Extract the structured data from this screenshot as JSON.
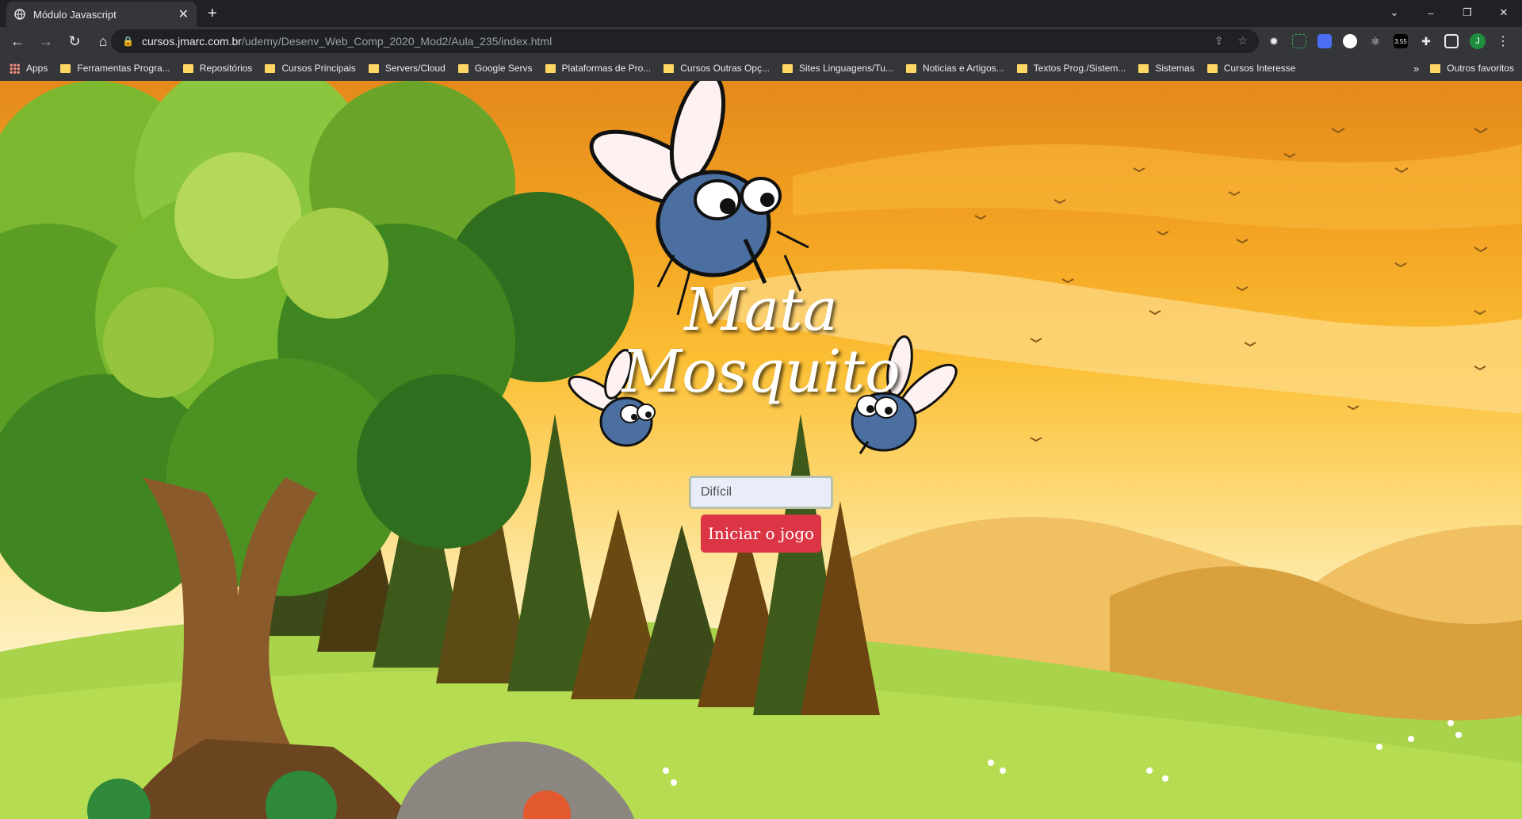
{
  "browser": {
    "tab_title": "Módulo Javascript",
    "tab_close": "✕",
    "new_tab": "+",
    "window_controls": [
      "⌄",
      "–",
      "❐",
      "✕"
    ],
    "url_host": "cursos.jmarc.com.br",
    "url_path": "/udemy/Desenv_Web_Comp_2020_Mod2/Aula_235/index.html",
    "extension_badge": "3.55",
    "profile_initial": "J"
  },
  "bookmarks": {
    "items": [
      "Apps",
      "Ferramentas Progra...",
      "Repositórios",
      "Cursos Principais",
      "Servers/Cloud",
      "Google Servs",
      "Plataformas de Pro...",
      "Cursos Outras Opç...",
      "Sites Linguagens/Tu...",
      "Noticias e Artigos...",
      "Textos Prog./Sistem...",
      "Sistemas",
      "Cursos Interesse"
    ],
    "overflow": "»",
    "other": "Outros favoritos"
  },
  "game": {
    "title_line1": "Mata",
    "title_line2": "Mosquito",
    "difficulty_value": "Difícil",
    "start_label": "Iniciar o jogo"
  }
}
